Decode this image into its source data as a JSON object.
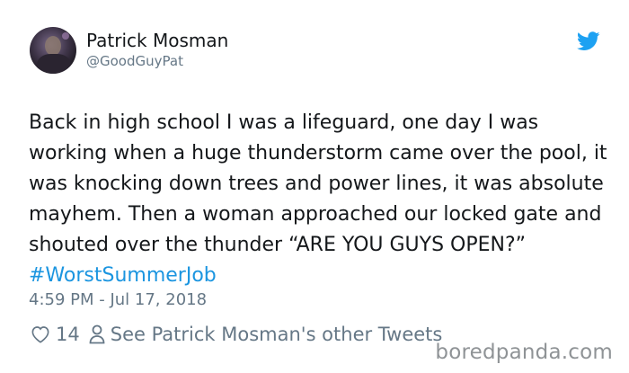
{
  "tweet": {
    "author_name": "Patrick Mosman",
    "author_handle": "@GoodGuyPat",
    "text_main": "Back in high school I was a lifeguard, one day I was working when a huge thunderstorm came over the pool, it was knocking down trees and power lines, it was absolute mayhem. Then a woman approached our locked gate and shouted over the thunder “ARE YOU GUYS OPEN?”",
    "hashtag": "#WorstSummerJob",
    "timestamp": "4:59 PM - Jul 17, 2018",
    "like_count": "14",
    "other_tweets_label": "See Patrick Mosman's other Tweets"
  },
  "watermark": "boredpanda.com",
  "colors": {
    "accent": "#1b95e0",
    "text": "#14171a",
    "muted": "#657786"
  },
  "icons": [
    "twitter-bird-icon",
    "heart-icon",
    "person-icon"
  ]
}
